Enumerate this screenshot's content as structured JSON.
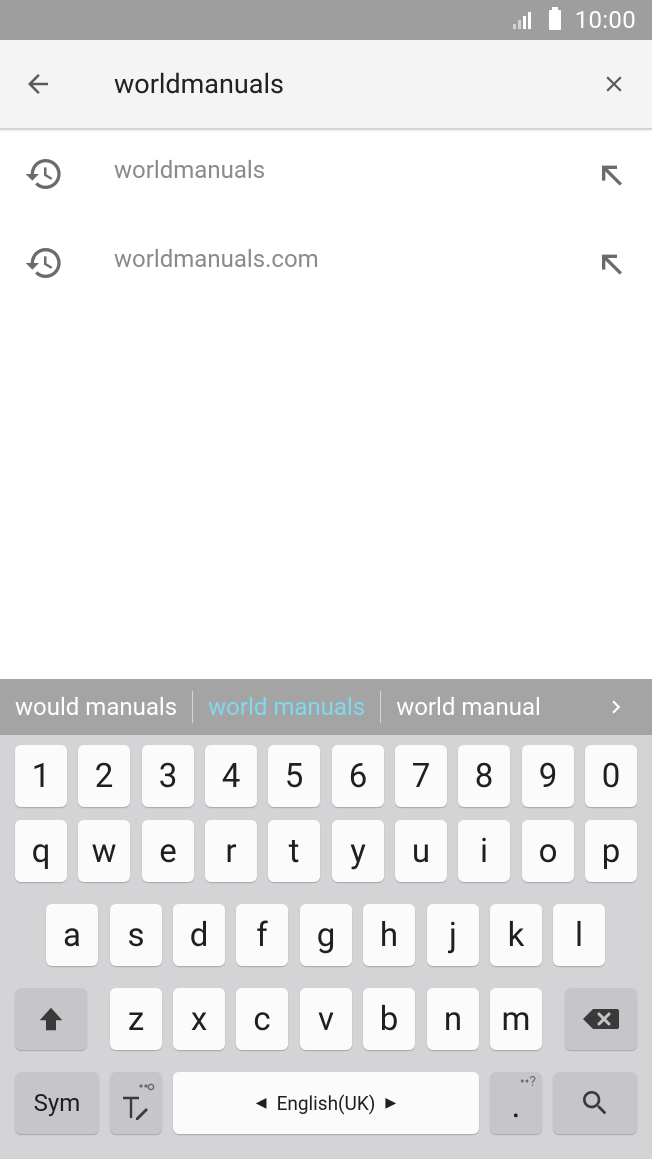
{
  "status": {
    "time": "10:00"
  },
  "search": {
    "value": "worldmanuals",
    "placeholder": ""
  },
  "suggestions": [
    {
      "text": "worldmanuals"
    },
    {
      "text": "worldmanuals.com"
    }
  ],
  "predictions": [
    "would manuals",
    "world manuals",
    "world manual"
  ],
  "keyboard": {
    "numbers": [
      "1",
      "2",
      "3",
      "4",
      "5",
      "6",
      "7",
      "8",
      "9",
      "0"
    ],
    "row1": [
      "q",
      "w",
      "e",
      "r",
      "t",
      "y",
      "u",
      "i",
      "o",
      "p"
    ],
    "row2": [
      "a",
      "s",
      "d",
      "f",
      "g",
      "h",
      "j",
      "k",
      "l"
    ],
    "row3": [
      "z",
      "x",
      "c",
      "v",
      "b",
      "n",
      "m"
    ],
    "sym": "Sym",
    "language": "English(UK)",
    "period": ".",
    "period_hint": "••?"
  },
  "colors": {
    "status_bar": "#9e9e9e",
    "prediction_active": "#7fd9ef",
    "keyboard_bg": "#d4d4d7"
  },
  "icons": [
    "signal-icon",
    "battery-icon",
    "back-arrow-icon",
    "close-icon",
    "history-icon",
    "insert-arrow-icon",
    "chevron-right-icon",
    "shift-icon",
    "backspace-icon",
    "text-settings-icon",
    "search-icon"
  ]
}
